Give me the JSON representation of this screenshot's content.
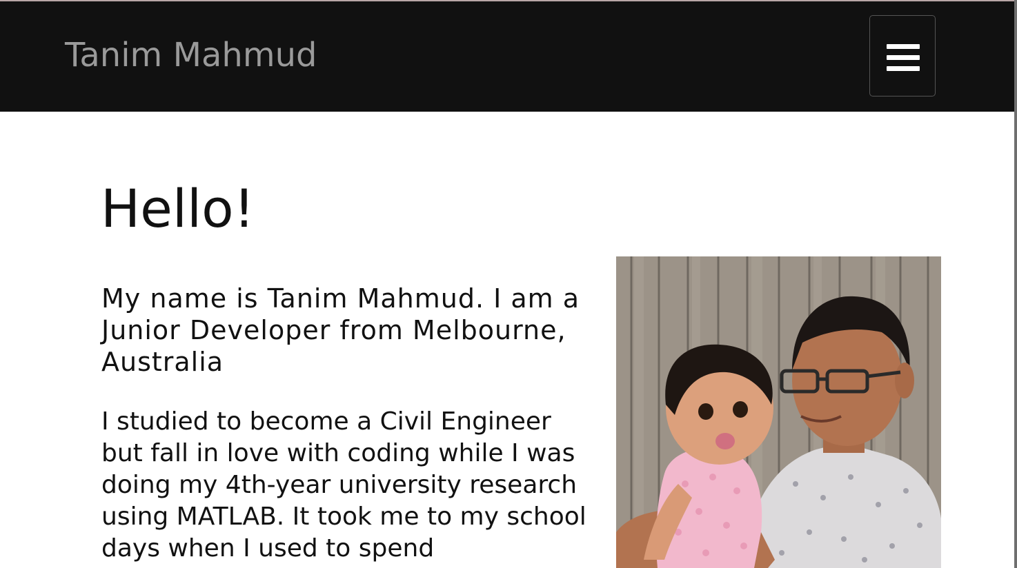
{
  "header": {
    "brand": "Tanim Mahmud",
    "menu_icon": "hamburger-menu-icon"
  },
  "main": {
    "heading": "Hello!",
    "intro": "My name is Tanim Mahmud. I am a Junior Developer from Melbourne, Australia",
    "bio": "I studied to become a Civil Engineer but fall in love with coding while I was doing my 4th-year university research using MATLAB. It took me to my school days when I used to spend"
  },
  "colors": {
    "navbar_bg": "#111111",
    "brand_text": "#9a9a9a",
    "body_text": "#111111",
    "page_bg": "#ffffff"
  }
}
